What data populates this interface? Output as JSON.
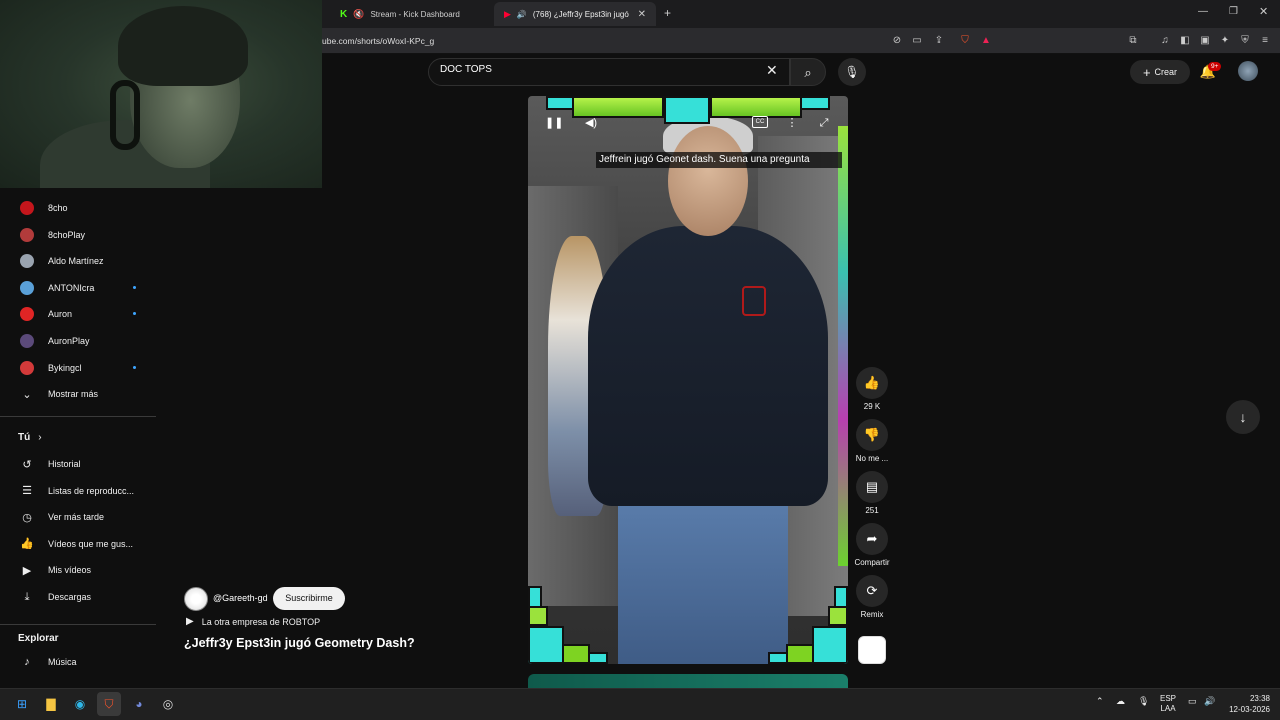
{
  "browser": {
    "tabs": [
      {
        "label": "Stream - Kick Dashboard",
        "active": false
      },
      {
        "label": "(768) ¿Jeffr3y Epst3in jugó Ge",
        "active": true
      }
    ],
    "url": "ube.com/shorts/oWoxI-KPc_g"
  },
  "header": {
    "search_query": "DOC TOPS",
    "create_label": "Crear",
    "notif_count": "9+"
  },
  "sidebar": {
    "subscriptions": [
      {
        "name": "8cho",
        "color": "#c4161c",
        "dot": false
      },
      {
        "name": "8choPlay",
        "color": "#b23b3b",
        "dot": false
      },
      {
        "name": "Aldo Martínez",
        "color": "#9aa4b0",
        "dot": false
      },
      {
        "name": "ANTONIcra",
        "color": "#5aa0d8",
        "dot": true
      },
      {
        "name": "Auron",
        "color": "#e02525",
        "dot": true
      },
      {
        "name": "AuronPlay",
        "color": "#5b4a7a",
        "dot": false
      },
      {
        "name": "Bykingcl",
        "color": "#d33a3a",
        "dot": true
      }
    ],
    "show_more": "Mostrar más",
    "you_title": "Tú",
    "you_items": [
      {
        "label": "Historial",
        "icon": "history-icon"
      },
      {
        "label": "Listas de reproducc...",
        "icon": "playlist-icon"
      },
      {
        "label": "Ver más tarde",
        "icon": "clock-icon"
      },
      {
        "label": "Vídeos que me gus...",
        "icon": "thumbs-up-icon"
      },
      {
        "label": "Mis vídeos",
        "icon": "video-icon"
      },
      {
        "label": "Descargas",
        "icon": "download-icon"
      }
    ],
    "explore_title": "Explorar",
    "explore_items": [
      {
        "label": "Música",
        "icon": "music-icon"
      }
    ]
  },
  "video": {
    "caption": "Jeffrein jugó Geonet dash. Suena una pregunta",
    "channel": "@Gareeth-gd",
    "subscribe_label": "Suscribirme",
    "music": "La otra empresa de ROBTOP",
    "title": "¿Jeffr3y Epst3in jugó Geometry Dash?",
    "cc_label": "CC"
  },
  "actions": {
    "likes": "29 K",
    "dislike": "No me ...",
    "comments": "251",
    "share": "Compartir",
    "remix": "Remix"
  },
  "taskbar": {
    "lang": "ESP",
    "lang2": "LAA",
    "time": "23:38",
    "date": "12-03-2026"
  }
}
